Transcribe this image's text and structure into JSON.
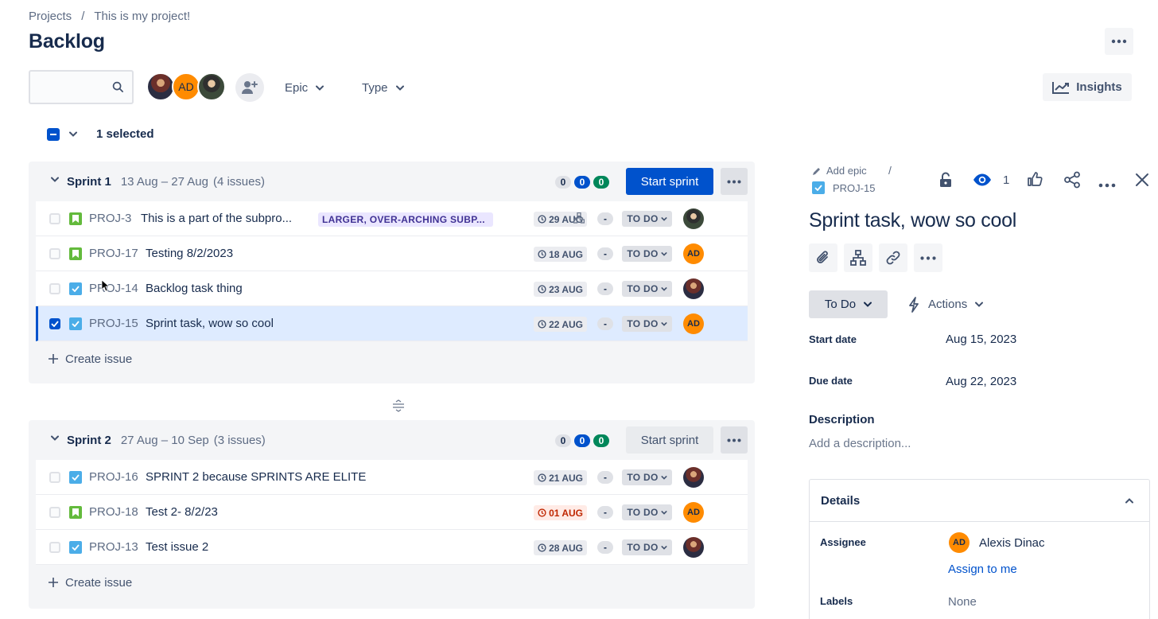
{
  "breadcrumb": {
    "root": "Projects",
    "separator": "/",
    "project": "This is my project!"
  },
  "page": {
    "title": "Backlog"
  },
  "toolbar": {
    "search_placeholder": "",
    "avatars": [
      {
        "type": "photo"
      },
      {
        "type": "initials",
        "initials": "AD",
        "color": "#ff8b00"
      },
      {
        "type": "photo"
      }
    ],
    "filters": [
      {
        "label": "Epic"
      },
      {
        "label": "Type"
      }
    ],
    "insights_label": "Insights"
  },
  "selection": {
    "label": "1 selected"
  },
  "sprints": [
    {
      "name": "Sprint 1",
      "dates": "13 Aug – 27 Aug",
      "count": "(4 issues)",
      "pills": [
        "0",
        "0",
        "0"
      ],
      "start_label": "Start sprint",
      "issues": [
        {
          "key": "PROJ-3",
          "type": "story",
          "summary": "This is a part of the subpro...",
          "epic": "LARGER, OVER-ARCHING SUBP...",
          "due": "29 AUG",
          "estimate": "-",
          "status": "TO DO",
          "assignee": "photo-a",
          "has_child": true
        },
        {
          "key": "PROJ-17",
          "type": "story",
          "summary": "Testing 8/2/2023",
          "due": "18 AUG",
          "estimate": "-",
          "status": "TO DO",
          "assignee": "AD"
        },
        {
          "key": "PROJ-14",
          "type": "task",
          "summary": "Backlog task thing",
          "due": "23 AUG",
          "estimate": "-",
          "status": "TO DO",
          "assignee": "photo-b"
        },
        {
          "key": "PROJ-15",
          "type": "task",
          "summary": "Sprint task, wow so cool",
          "due": "22 AUG",
          "estimate": "-",
          "status": "TO DO",
          "assignee": "AD",
          "selected": true
        }
      ],
      "create_label": "Create issue"
    },
    {
      "name": "Sprint 2",
      "dates": "27 Aug – 10 Sep",
      "count": "(3 issues)",
      "pills": [
        "0",
        "0",
        "0"
      ],
      "start_label": "Start sprint",
      "issues": [
        {
          "key": "PROJ-16",
          "type": "task",
          "summary": "SPRINT 2 because SPRINTS ARE ELITE",
          "due": "21 AUG",
          "estimate": "-",
          "status": "TO DO",
          "assignee": "photo-b"
        },
        {
          "key": "PROJ-18",
          "type": "story",
          "summary": "Test 2- 8/2/23",
          "due": "01 AUG",
          "overdue": true,
          "estimate": "-",
          "status": "TO DO",
          "assignee": "AD"
        },
        {
          "key": "PROJ-13",
          "type": "task",
          "summary": "Test issue 2",
          "due": "28 AUG",
          "estimate": "-",
          "status": "TO DO",
          "assignee": "photo-b"
        }
      ],
      "create_label": "Create issue"
    }
  ],
  "detail": {
    "add_epic": "Add epic",
    "slash": "/",
    "key": "PROJ-15",
    "watch_count": "1",
    "title": "Sprint task, wow so cool",
    "status": "To Do",
    "actions_label": "Actions",
    "start_date_label": "Start date",
    "start_date": "Aug 15, 2023",
    "due_date_label": "Due date",
    "due_date": "Aug 22, 2023",
    "description_label": "Description",
    "description_placeholder": "Add a description...",
    "details_label": "Details",
    "assignee_label": "Assignee",
    "assignee_initials": "AD",
    "assignee_name": "Alexis Dinac",
    "assign_to_me": "Assign to me",
    "labels_label": "Labels",
    "labels_value": "None"
  },
  "colors": {
    "primary": "#0052cc",
    "story": "#63ba3c",
    "task": "#4bade8",
    "epic_bg": "#eae6ff",
    "epic_text": "#403294",
    "avatar_orange": "#ff8b00"
  }
}
